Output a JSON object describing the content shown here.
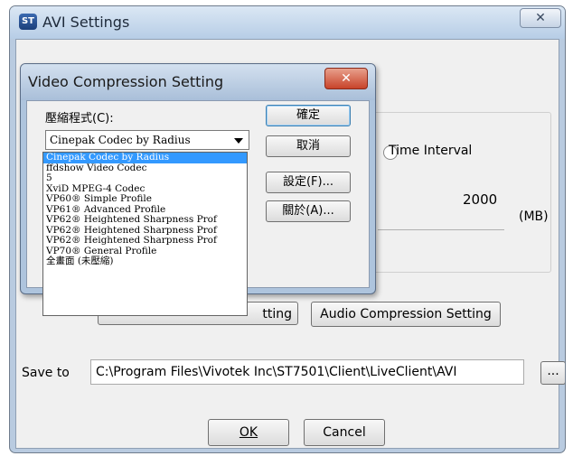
{
  "outer_dialog": {
    "title": "AVI Settings",
    "app_icon": "ST",
    "close_glyph": "✕",
    "partial_value": "2000",
    "unit_label": "(MB)",
    "time_interval_label": "Time Interval",
    "video_compression_button_fragment": "tting",
    "audio_compression_button": "Audio Compression Setting",
    "save_to_label": "Save to",
    "save_to_path": "C:\\Program Files\\Vivotek Inc\\ST7501\\Client\\LiveClient\\AVI",
    "browse_button": "...",
    "ok_button": "OK",
    "cancel_button": "Cancel"
  },
  "inner_dialog": {
    "title": "Video Compression Setting",
    "close_glyph": "✕",
    "compressor_label": "壓縮程式(C):",
    "selected_codec": "Cinepak Codec by Radius",
    "ok_button": "確定",
    "cancel_button": "取消",
    "settings_button": "設定(F)...",
    "about_button": "關於(A)..."
  },
  "codec_list": [
    "Cinepak Codec by Radius",
    "ffdshow Video Codec",
    "5",
    "XviD MPEG-4 Codec",
    "VP60® Simple Profile",
    "VP61® Advanced Profile",
    "VP62® Heightened Sharpness Prof",
    "VP62® Heightened Sharpness Prof",
    "VP62® Heightened Sharpness Prof",
    "VP70® General Profile",
    "全畫面 (未壓縮)"
  ],
  "colors": {
    "selection": "#3399ff",
    "window_face": "#f0f0f0",
    "close_button_red": "#c8432a"
  }
}
